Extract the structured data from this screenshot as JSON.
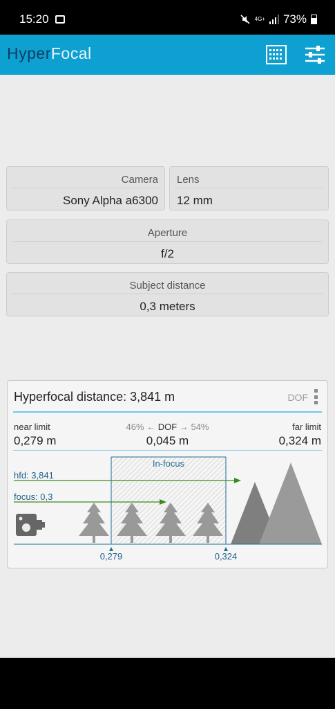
{
  "status": {
    "time": "15:20",
    "network": "4G+",
    "battery": "73%"
  },
  "app": {
    "title_part1": "Hyper",
    "title_part2": "Focal"
  },
  "toolbar": {
    "calendar_icon": "grid-calendar-icon",
    "settings_icon": "sliders-icon"
  },
  "inputs": {
    "camera": {
      "label": "Camera",
      "value": "Sony Alpha a6300"
    },
    "lens": {
      "label": "Lens",
      "value": "12 mm"
    },
    "aperture": {
      "label": "Aperture",
      "value": "f/2"
    },
    "subject": {
      "label": "Subject distance",
      "value": "0,3 meters"
    }
  },
  "result": {
    "title": "Hyperfocal distance: 3,841 m",
    "dof_menu": "DOF",
    "near_label": "near limit",
    "near_value": "0,279 m",
    "far_label": "far limit",
    "far_value": "0,324 m",
    "dof_left_pct": "46%",
    "dof_word": "DOF",
    "dof_right_pct": "54%",
    "dof_value": "0,045 m",
    "in_focus_label": "In-focus",
    "hfd_label": "hfd: 3,841",
    "focus_label": "focus: 0,3",
    "near_tick": "0,279",
    "far_tick": "0,324"
  },
  "colors": {
    "accent": "#0fa0d2",
    "arrow": "#3f8a1e",
    "line": "#1f6f8f",
    "trees": "#9a9a9a"
  }
}
